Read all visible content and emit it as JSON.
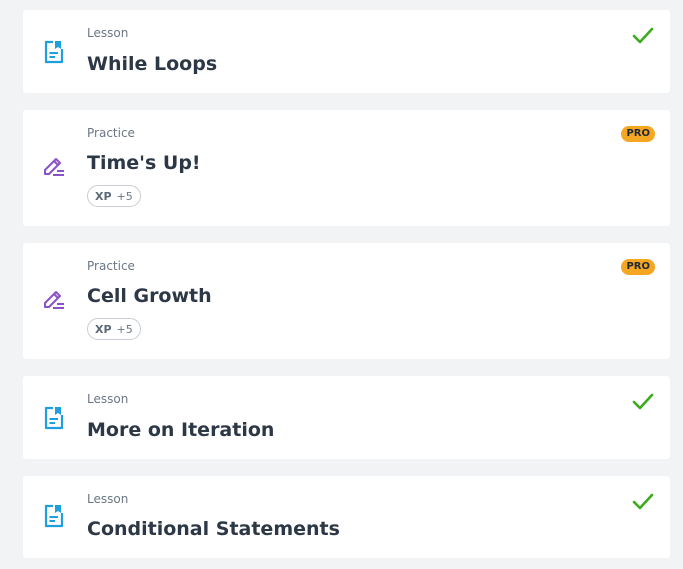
{
  "colors": {
    "background": "#f1f3f5",
    "card": "#ffffff",
    "lesson_icon": "#1e9fe0",
    "practice_icon": "#8a52c9",
    "check": "#3cab1e",
    "pro_badge": "#f5a623",
    "title_text": "#2d3846",
    "muted_text": "#6b7785"
  },
  "items": [
    {
      "kind": "lesson",
      "icon": "lesson-document-icon",
      "type_label": "Lesson",
      "title": "While Loops",
      "completed": true,
      "status_icon": "checkmark-icon"
    },
    {
      "kind": "practice",
      "icon": "practice-pencil-icon",
      "type_label": "Practice",
      "title": "Time's Up!",
      "pro_label": "PRO",
      "xp_label": "XP",
      "xp_value": "+5"
    },
    {
      "kind": "practice",
      "icon": "practice-pencil-icon",
      "type_label": "Practice",
      "title": "Cell Growth",
      "pro_label": "PRO",
      "xp_label": "XP",
      "xp_value": "+5"
    },
    {
      "kind": "lesson",
      "icon": "lesson-document-icon",
      "type_label": "Lesson",
      "title": "More on Iteration",
      "completed": true,
      "status_icon": "checkmark-icon"
    },
    {
      "kind": "lesson",
      "icon": "lesson-document-icon",
      "type_label": "Lesson",
      "title": "Conditional Statements",
      "completed": true,
      "status_icon": "checkmark-icon"
    }
  ]
}
